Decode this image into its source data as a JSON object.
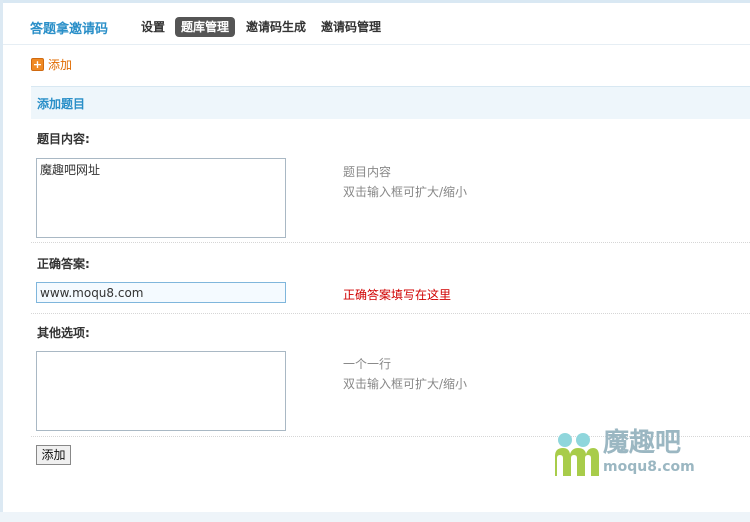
{
  "header": {
    "app_title": "答题拿邀请码",
    "nav": [
      {
        "label": "设置",
        "active": false
      },
      {
        "label": "题库管理",
        "active": true
      },
      {
        "label": "邀请码生成",
        "active": false
      },
      {
        "label": "邀请码管理",
        "active": false
      }
    ]
  },
  "toolbar": {
    "add_label": "添加"
  },
  "form": {
    "section_title": "添加题目",
    "question": {
      "label": "题目内容:",
      "value": "魔趣吧网址",
      "hint_line1": "题目内容",
      "hint_line2": "双击输入框可扩大/缩小"
    },
    "answer": {
      "label": "正确答案:",
      "value": "www.moqu8.com",
      "hint": "正确答案填写在这里"
    },
    "options": {
      "label": "其他选项:",
      "value": "",
      "hint_line1": "一个一行",
      "hint_line2": "双击输入框可扩大/缩小"
    },
    "submit_label": "添加"
  },
  "watermark": {
    "brand": "魔趣吧",
    "url": "moqu8.com"
  },
  "colors": {
    "accent": "#2a8fc8",
    "link_orange": "#e06b00",
    "hint_red": "#d00000",
    "active_tab": "#555555"
  }
}
